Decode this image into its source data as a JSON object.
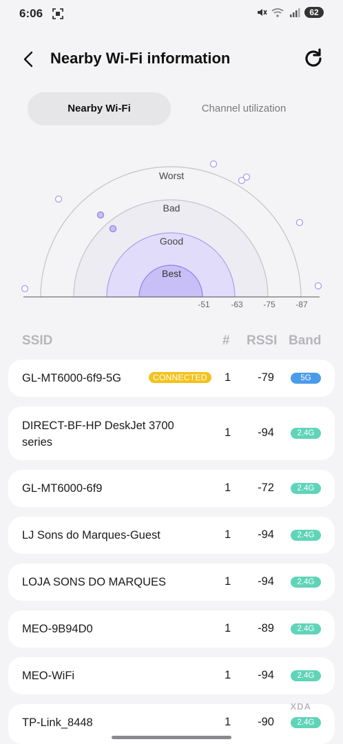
{
  "status_bar": {
    "time": "6:06",
    "battery": "62"
  },
  "header": {
    "title": "Nearby Wi-Fi information"
  },
  "tabs": [
    {
      "label": "Nearby Wi-Fi",
      "active": true
    },
    {
      "label": "Channel utilization",
      "active": false
    }
  ],
  "signal_chart": {
    "zones": [
      "Best",
      "Good",
      "Bad",
      "Worst"
    ],
    "scale_labels": [
      "-51",
      "-63",
      "-75",
      "-87"
    ],
    "colors": {
      "best": "#c9bff7",
      "good": "#e2dcfb",
      "bad": "#ececf2",
      "worst": "#f4f4f6",
      "dot": "#a99cf0"
    }
  },
  "table": {
    "headers": {
      "ssid": "SSID",
      "num": "#",
      "rssi": "RSSI",
      "band": "Band"
    },
    "connected_label": "CONNECTED",
    "rows": [
      {
        "ssid": "GL-MT6000-6f9-5G",
        "connected": true,
        "num": "1",
        "rssi": "-79",
        "band": "5G"
      },
      {
        "ssid": "DIRECT-BF-HP DeskJet 3700 series",
        "connected": false,
        "num": "1",
        "rssi": "-94",
        "band": "2.4G"
      },
      {
        "ssid": "GL-MT6000-6f9",
        "connected": false,
        "num": "1",
        "rssi": "-72",
        "band": "2.4G"
      },
      {
        "ssid": "LJ Sons do Marques-Guest",
        "connected": false,
        "num": "1",
        "rssi": "-94",
        "band": "2.4G"
      },
      {
        "ssid": "LOJA SONS DO MARQUES",
        "connected": false,
        "num": "1",
        "rssi": "-94",
        "band": "2.4G"
      },
      {
        "ssid": "MEO-9B94D0",
        "connected": false,
        "num": "1",
        "rssi": "-89",
        "band": "2.4G"
      },
      {
        "ssid": "MEO-WiFi",
        "connected": false,
        "num": "1",
        "rssi": "-94",
        "band": "2.4G"
      },
      {
        "ssid": "TP-Link_8448",
        "connected": false,
        "num": "1",
        "rssi": "-90",
        "band": "2.4G"
      }
    ]
  },
  "watermark": "XDA"
}
